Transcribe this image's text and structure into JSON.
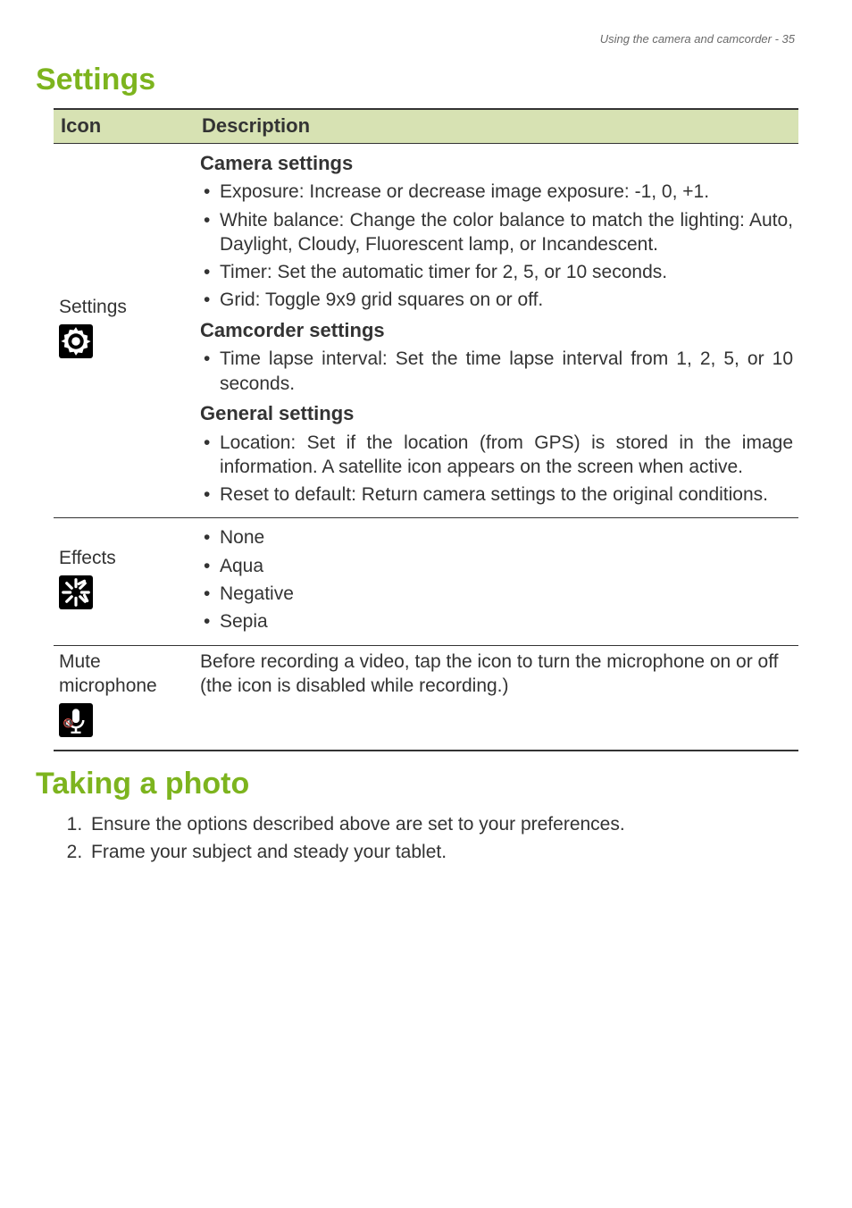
{
  "header": {
    "right": "Using the camera and camcorder - 35"
  },
  "sections": {
    "settings_title": "Settings",
    "taking_photo_title": "Taking a photo"
  },
  "table": {
    "col_icon": "Icon",
    "col_desc": "Description",
    "rows": {
      "settings": {
        "label": "Settings",
        "camera_h": "Camera settings",
        "camera_items": [
          "Exposure: Increase or decrease image exposure: -1, 0, +1.",
          "White balance: Change the color balance to match the lighting: Auto, Daylight, Cloudy, Fluorescent lamp, or Incandescent.",
          "Timer: Set the automatic timer for 2, 5, or 10 seconds.",
          "Grid: Toggle 9x9 grid squares on or off."
        ],
        "cam_h": "Camcorder settings",
        "cam_items": [
          "Time lapse interval: Set the time lapse interval from 1, 2, 5, or 10 seconds."
        ],
        "gen_h": "General settings",
        "gen_items": [
          "Location: Set if the location (from GPS) is stored in the image information. A satellite icon appears on the screen when active.",
          "Reset to default: Return camera settings to the original conditions."
        ]
      },
      "effects": {
        "label": "Effects",
        "items": [
          "None",
          "Aqua",
          "Negative",
          "Sepia"
        ]
      },
      "mute": {
        "label": "Mute microphone",
        "desc": "Before recording a video, tap the icon to turn the microphone on or off (the icon is disabled while recording.)"
      }
    }
  },
  "steps": [
    "Ensure the options described above are set to your preferences.",
    "Frame your subject and steady your tablet."
  ]
}
